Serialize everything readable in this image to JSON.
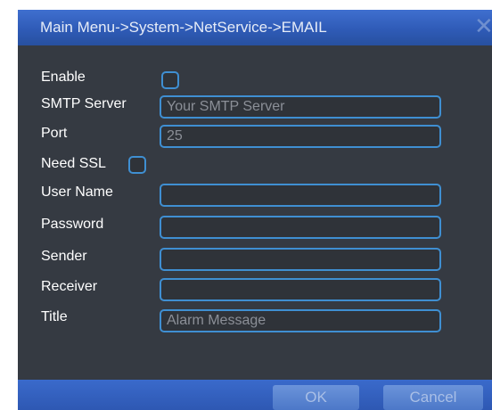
{
  "window": {
    "title": "Main Menu->System->NetService->EMAIL",
    "close_glyph": "✕"
  },
  "form": {
    "enable": {
      "label": "Enable",
      "checked": false
    },
    "smtp_server": {
      "label": "SMTP Server",
      "value": "Your SMTP Server"
    },
    "port": {
      "label": "Port",
      "value": "25"
    },
    "need_ssl": {
      "label": "Need SSL",
      "checked": false
    },
    "user_name": {
      "label": "User Name",
      "value": ""
    },
    "password": {
      "label": "Password",
      "value": ""
    },
    "sender": {
      "label": "Sender",
      "value": ""
    },
    "receiver": {
      "label": "Receiver",
      "value": ""
    },
    "title": {
      "label": "Title",
      "value": "Alarm Message"
    }
  },
  "buttons": {
    "ok_label": "OK",
    "cancel_label": "Cancel"
  },
  "colors": {
    "accent": "#3f8fd2",
    "titlebar": "#2f5bb7",
    "panel": "#353a42"
  }
}
